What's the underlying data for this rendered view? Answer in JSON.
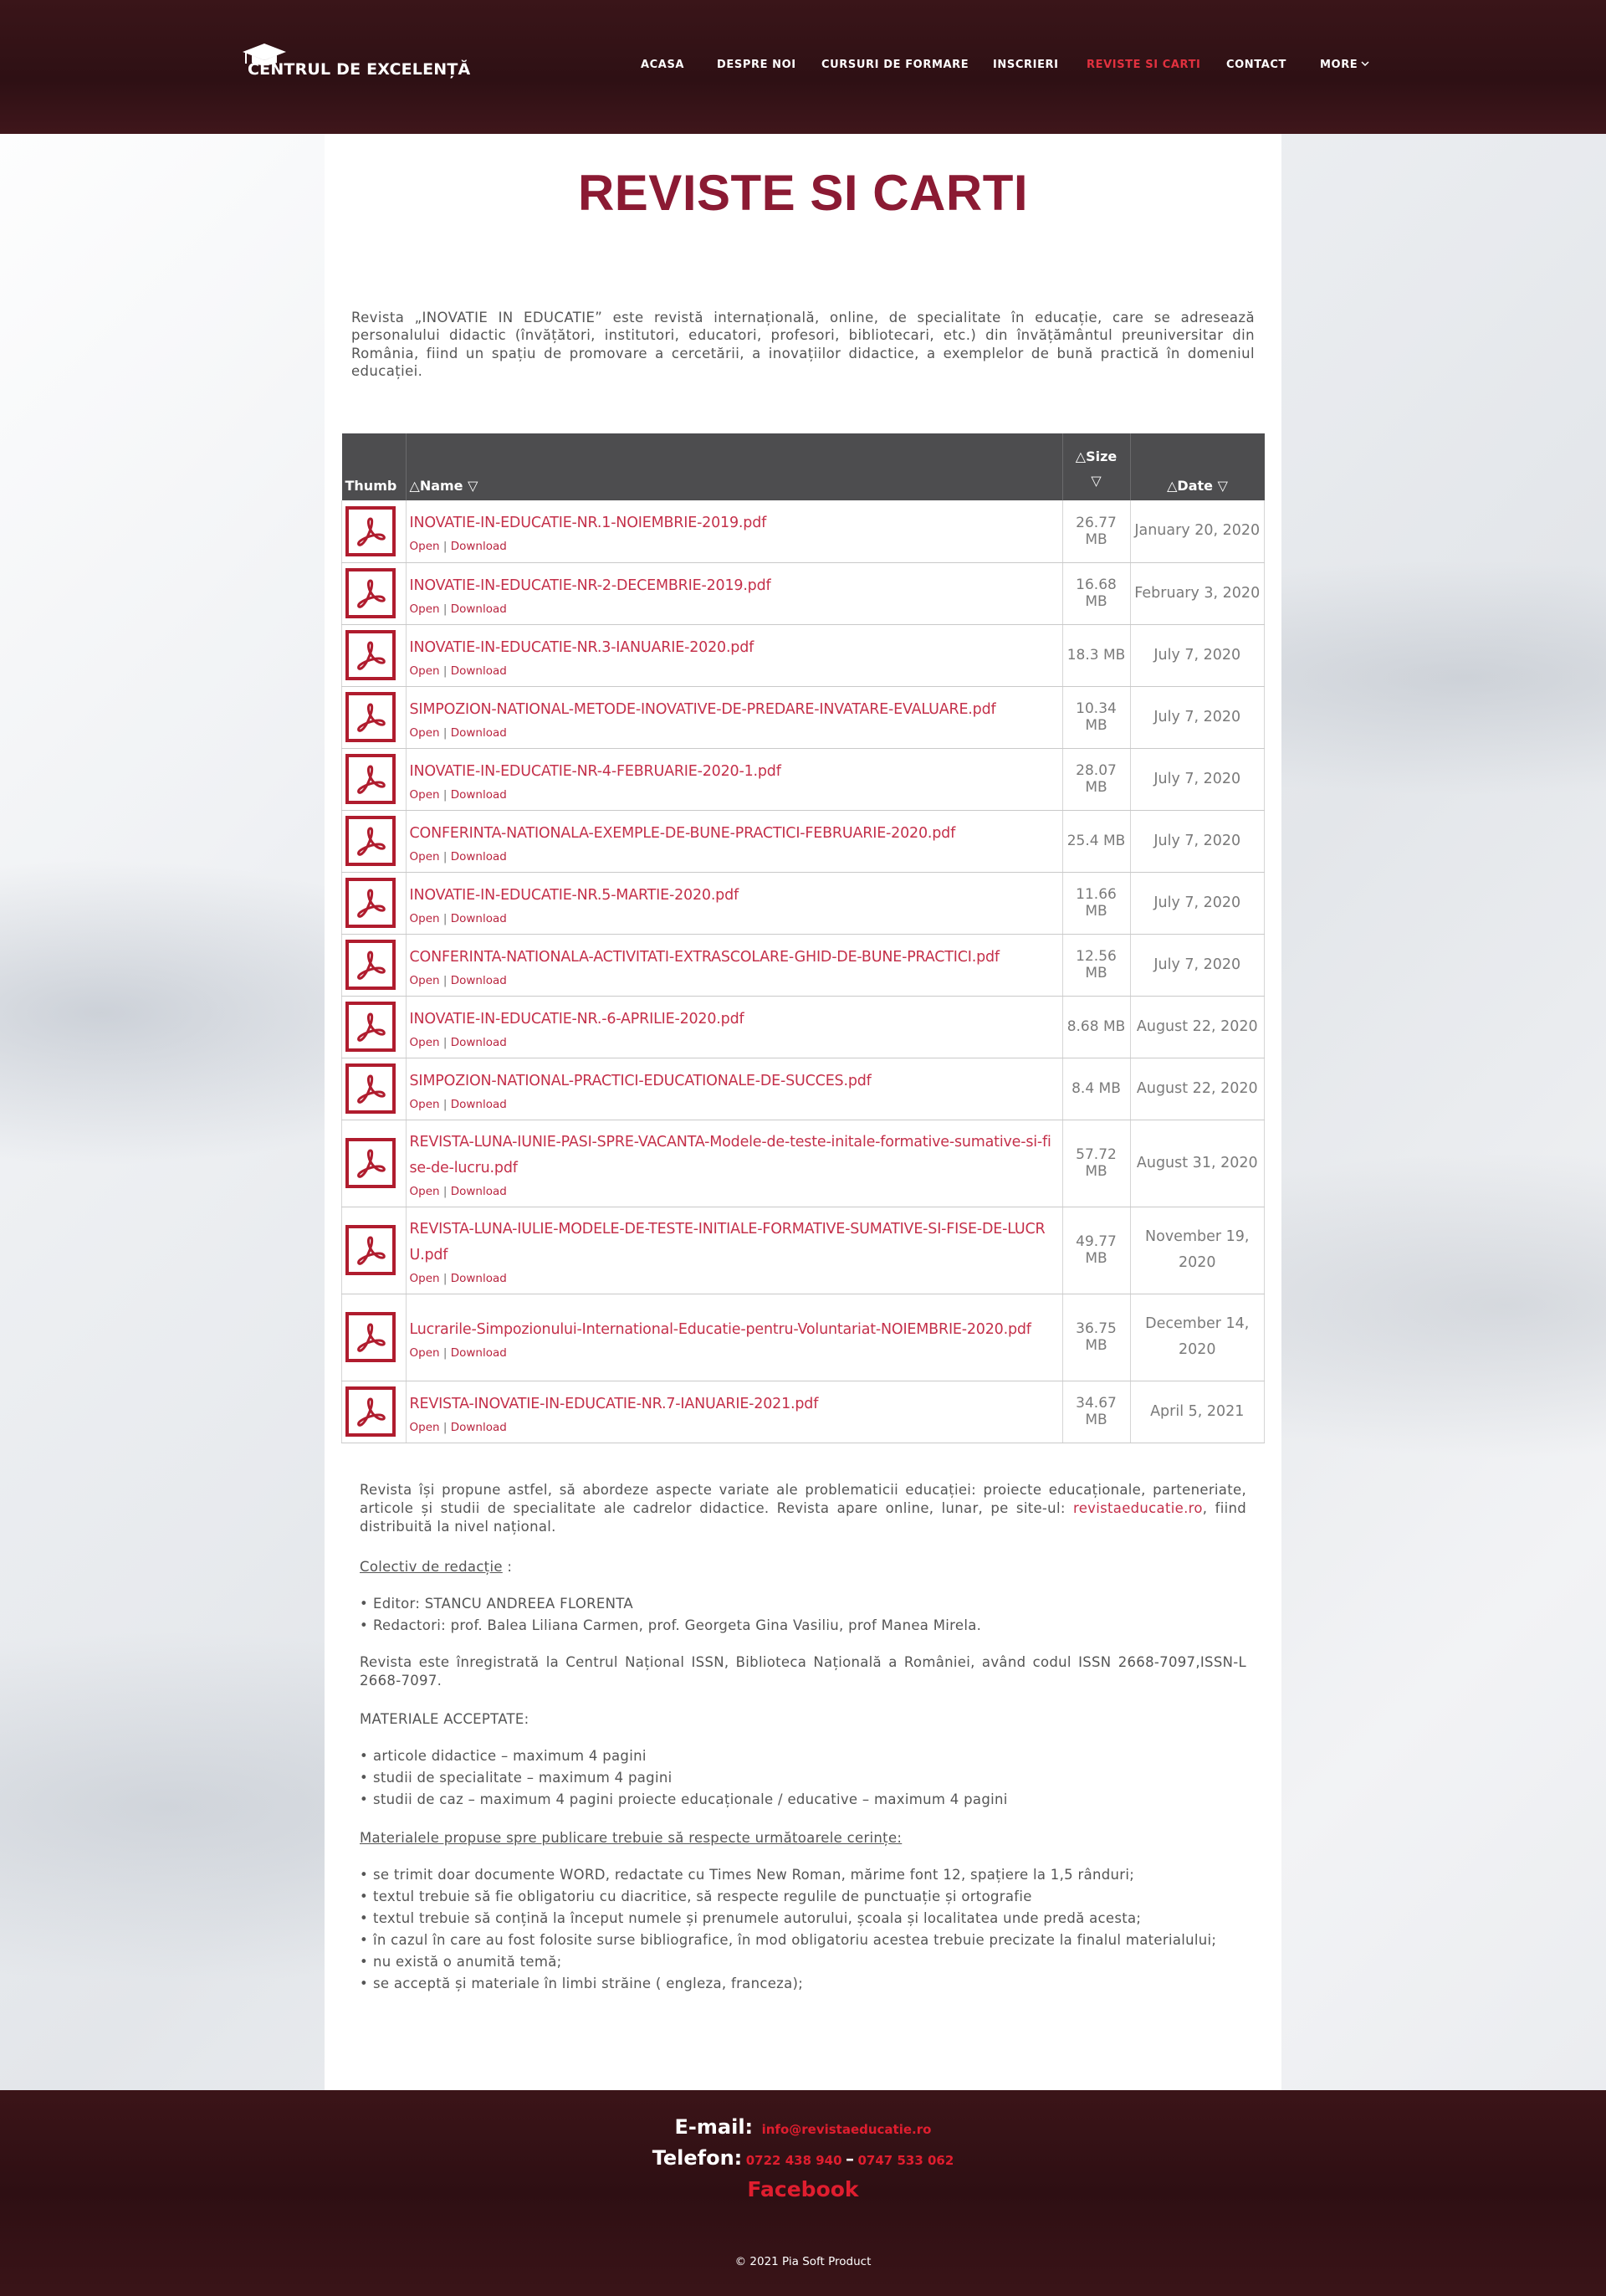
{
  "brand": {
    "logo_text": "CENTRUL DE EXCELENȚĂ"
  },
  "nav": {
    "items": [
      "ACASA",
      "DESPRE NOI",
      "CURSURI DE FORMARE",
      "INSCRIERI",
      "REVISTE SI CARTI",
      "CONTACT",
      "MORE"
    ],
    "active": "REVISTE SI CARTI"
  },
  "page": {
    "title": "REVISTE SI CARTI",
    "intro": "Revista „INOVATIE IN EDUCATIE” este revistă internațională, online, de specialitate în educație, care se adresează personalului didactic (învățători, institutori, educatori, profesori, bibliotecari, etc.) din învățământul preuniversitar din România, fiind un spațiu de promovare a cercetării, a inovațiilor didactice, a exemplelor de bună practică în domeniul educației."
  },
  "table": {
    "headers": {
      "thumb": "Thumb",
      "name": "Name",
      "size": "Size",
      "date": "Date"
    },
    "open_label": "Open",
    "download_label": "Download",
    "separator": "|",
    "rows": [
      {
        "name": "INOVATIE-IN-EDUCATIE-NR.1-NOIEMBRIE-2019.pdf",
        "size": "26.77 MB",
        "date": "January 20, 2020"
      },
      {
        "name": "INOVATIE-IN-EDUCATIE-NR-2-DECEMBRIE-2019.pdf",
        "size": "16.68 MB",
        "date": "February 3, 2020"
      },
      {
        "name": "INOVATIE-IN-EDUCATIE-NR.3-IANUARIE-2020.pdf",
        "size": "18.3 MB",
        "date": "July 7, 2020"
      },
      {
        "name": "SIMPOZION-NATIONAL-METODE-INOVATIVE-DE-PREDARE-INVATARE-EVALUARE.pdf",
        "size": "10.34 MB",
        "date": "July 7, 2020"
      },
      {
        "name": "INOVATIE-IN-EDUCATIE-NR-4-FEBRUARIE-2020-1.pdf",
        "size": "28.07 MB",
        "date": "July 7, 2020"
      },
      {
        "name": "CONFERINTA-NATIONALA-EXEMPLE-DE-BUNE-PRACTICI-FEBRUARIE-2020.pdf",
        "size": "25.4 MB",
        "date": "July 7, 2020"
      },
      {
        "name": "INOVATIE-IN-EDUCATIE-NR.5-MARTIE-2020.pdf",
        "size": "11.66 MB",
        "date": "July 7, 2020"
      },
      {
        "name": "CONFERINTA-NATIONALA-ACTIVITATI-EXTRASCOLARE-GHID-DE-BUNE-PRACTICI.pdf",
        "size": "12.56 MB",
        "date": "July 7, 2020"
      },
      {
        "name": "INOVATIE-IN-EDUCATIE-NR.-6-APRILIE-2020.pdf",
        "size": "8.68 MB",
        "date": "August 22, 2020"
      },
      {
        "name": "SIMPOZION-NATIONAL-PRACTICI-EDUCATIONALE-DE-SUCCES.pdf",
        "size": "8.4 MB",
        "date": "August 22, 2020"
      },
      {
        "name": "REVISTA-LUNA-IUNIE-PASI-SPRE-VACANTA-Modele-de-teste-initale-formative-sumative-si-fise-de-lucru.pdf",
        "size": "57.72 MB",
        "date": "August 31, 2020"
      },
      {
        "name": "REVISTA-LUNA-IULIE-MODELE-DE-TESTE-INITIALE-FORMATIVE-SUMATIVE-SI-FISE-DE-LUCRU.pdf",
        "size": "49.77 MB",
        "date": "November 19, 2020"
      },
      {
        "name": "Lucrarile-Simpozionului-International-Educatie-pentru-Voluntariat-NOIEMBRIE-2020.pdf",
        "size": "36.75 MB",
        "date": "December 14, 2020"
      },
      {
        "name": "REVISTA-INOVATIE-IN-EDUCATIE-NR.7-IANUARIE-2021.pdf",
        "size": "34.67 MB",
        "date": "April 5, 2021"
      }
    ]
  },
  "lower": {
    "p1_before": "Revista își propune astfel, să abordeze aspecte variate ale problematicii educației: proiecte educaționale, parteneriate, articole și studii de specialitate ale cadrelor didactice. Revista apare online, lunar, pe site-ul: ",
    "p1_link": "revistaeducatie.ro",
    "p1_after": ", fiind distribuită la nivel național.",
    "editorial_heading": "Colectiv de redacție",
    "editorial_colon": " :",
    "editorial_items": [
      "Editor: STANCU ANDREEA FLORENTA",
      "Redactori: prof. Balea Liliana Carmen, prof. Georgeta Gina Vasiliu, prof Manea Mirela."
    ],
    "issn": "Revista este înregistrată la Centrul Național ISSN, Biblioteca Națională a României, având codul ISSN 2668-7097,ISSN-L 2668-7097.",
    "materials_heading": "MATERIALE ACCEPTATE:",
    "materials_items": [
      "articole didactice – maximum 4 pagini",
      "studii de specialitate – maximum 4 pagini",
      "studii de caz – maximum 4 pagini proiecte educaționale / educative – maximum 4 pagini"
    ],
    "requirements_heading": "Materialele propuse spre publicare trebuie să respecte următoarele cerințe:",
    "requirements_items": [
      "se trimit doar documente WORD, redactate cu Times New Roman, mărime font 12, spațiere la 1,5 rânduri;",
      "textul trebuie să fie obligatoriu cu diacritice, să respecte regulile de punctuație și ortografie",
      "textul trebuie să conțină la început numele și prenumele autorului, școala și localitatea unde predă acesta;",
      "în cazul în care au fost folosite surse bibliografice, în mod obligatoriu acestea trebuie precizate la finalul materialului;",
      "nu există o anumită temă;",
      "se acceptă și materiale în limbi străine ( engleza, franceza);"
    ]
  },
  "footer": {
    "email_label": "E-mail:",
    "email_value": "info@revistaeducatie.ro",
    "phone_label": "Telefon:",
    "phone_1": "0722 438 940",
    "phone_dash": "–",
    "phone_2": "0747 533 062",
    "facebook": "Facebook",
    "copyright": "© 2021 Pia Soft Product"
  },
  "colors": {
    "header_bg": "#2e1014",
    "title": "#8b1a33",
    "link": "#c4304a",
    "active_nav": "#e2313f",
    "footer_accent": "#e01e2f",
    "table_header_bg": "#4d4d4f"
  },
  "icons": {
    "logo": "graduation-cap-icon",
    "file": "pdf-icon",
    "more": "chevron-down-icon",
    "sort_up": "triangle-up-icon",
    "sort_down": "triangle-down-icon"
  }
}
